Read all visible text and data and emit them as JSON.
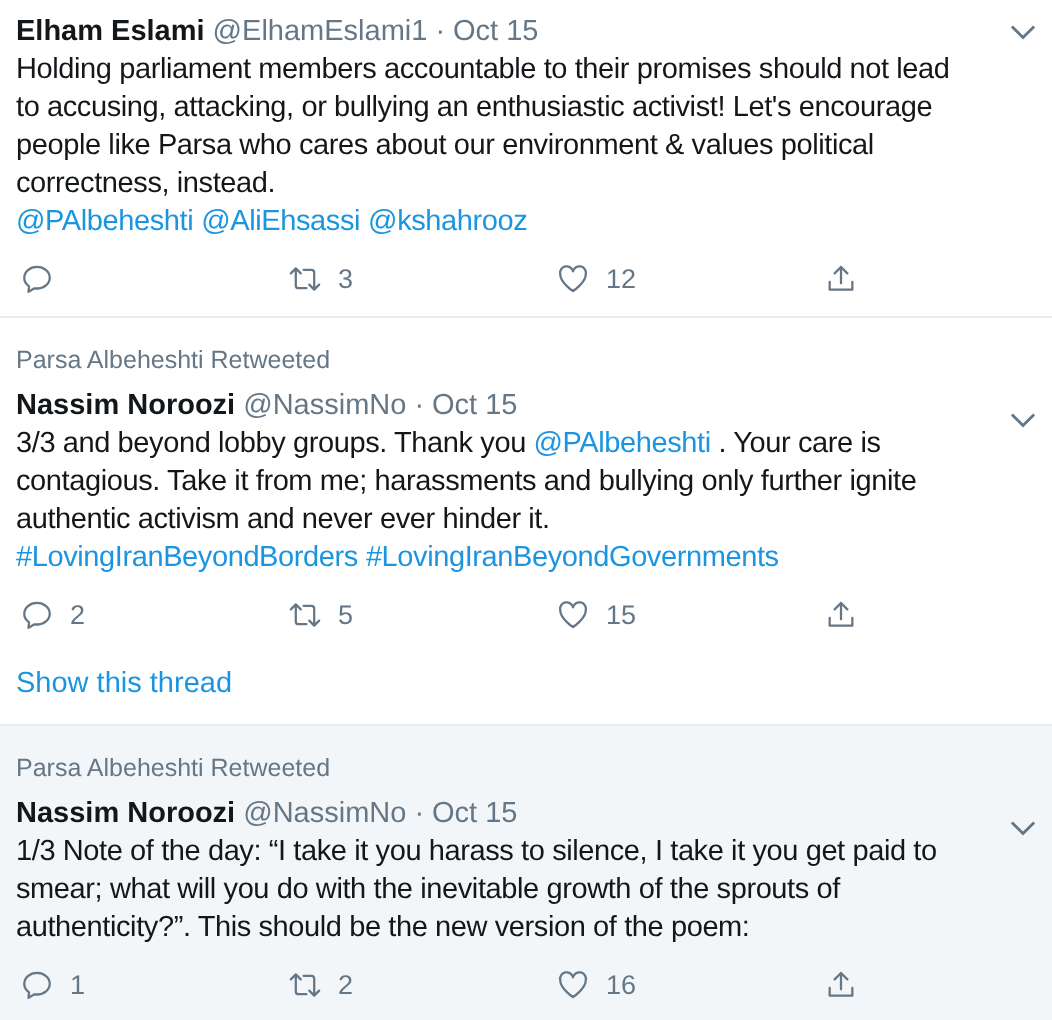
{
  "tweets": [
    {
      "highlighted": false,
      "name": "Elham Eslami",
      "handle": "@ElhamEslami1",
      "separator": "·",
      "date": "Oct 15",
      "lines": [
        [
          {
            "kind": "text",
            "text": "Holding parliament members accountable to their promises should not lead"
          }
        ],
        [
          {
            "kind": "text",
            "text": "to accusing, attacking, or bullying an enthusiastic activist! Let's encourage"
          }
        ],
        [
          {
            "kind": "text",
            "text": "people like Parsa who cares about our environment & values political"
          }
        ],
        [
          {
            "kind": "text",
            "text": "correctness, instead."
          }
        ],
        [
          {
            "kind": "link",
            "text": "@PAlbeheshti"
          },
          {
            "kind": "link",
            "text": "@AliEhsassi"
          },
          {
            "kind": "link",
            "text": "@kshahrooz"
          }
        ]
      ],
      "retweets": "3",
      "likes": "12"
    },
    {
      "retweeted_by": "Parsa Albeheshti Retweeted",
      "highlighted": false,
      "name": "Nassim Noroozi",
      "handle": "@NassimNo",
      "separator": "·",
      "date": "Oct 15",
      "lines": [
        [
          {
            "kind": "text",
            "text": "3/3 and beyond lobby groups. Thank you "
          },
          {
            "kind": "link",
            "text": "@PAlbeheshti"
          },
          {
            "kind": "text",
            "text": " . Your care is"
          }
        ],
        [
          {
            "kind": "text",
            "text": "contagious. Take it from me; harassments and bullying only further ignite"
          }
        ],
        [
          {
            "kind": "text",
            "text": "authentic activism and never ever hinder it."
          }
        ],
        [
          {
            "kind": "link",
            "text": "#LovingIranBeyondBorders"
          },
          {
            "kind": "link",
            "text": "#LovingIranBeyondGovernments"
          }
        ]
      ],
      "replies": "2",
      "retweets": "5",
      "likes": "15",
      "thread_link": "Show this thread"
    },
    {
      "retweeted_by": "Parsa Albeheshti Retweeted",
      "highlighted": true,
      "name": "Nassim Noroozi",
      "handle": "@NassimNo",
      "separator": "·",
      "date": "Oct 15",
      "lines": [
        [
          {
            "kind": "text",
            "text": "1/3 Note of the day: “I take it you harass to silence, I take it you get paid to"
          }
        ],
        [
          {
            "kind": "text",
            "text": "smear; what will you do with the inevitable growth of the sprouts of"
          }
        ],
        [
          {
            "kind": "text",
            "text": "authenticity?”. This should be the new version of the poem:"
          }
        ]
      ],
      "replies": "1",
      "retweets": "2",
      "likes": "16"
    }
  ]
}
